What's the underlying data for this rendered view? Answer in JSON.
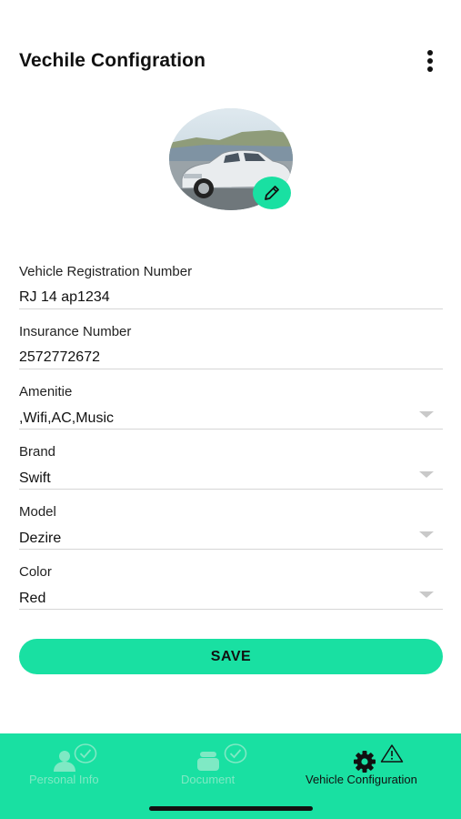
{
  "header": {
    "title": "Vechile Configration",
    "menu_icon": "more-vertical-icon"
  },
  "avatar": {
    "image": "car-photo",
    "edit_icon": "pencil-icon"
  },
  "form": {
    "fields": [
      {
        "label": "Vehicle Registration Number",
        "value": "RJ 14 ap1234",
        "type": "text"
      },
      {
        "label": "Insurance Number",
        "value": "2572772672",
        "type": "text"
      },
      {
        "label": "Amenitie",
        "value": ",Wifi,AC,Music",
        "type": "dropdown"
      },
      {
        "label": "Brand",
        "value": "Swift",
        "type": "dropdown"
      },
      {
        "label": "Model",
        "value": "Dezire",
        "type": "dropdown"
      },
      {
        "label": "Color",
        "value": "Red",
        "type": "dropdown"
      }
    ],
    "save_label": "SAVE"
  },
  "bottom_nav": {
    "items": [
      {
        "label": "Personal Info",
        "icon": "person-icon",
        "status": "check-circle-icon"
      },
      {
        "label": "Document",
        "icon": "document-stack-icon",
        "status": "check-circle-icon"
      },
      {
        "label": "Vehicle Configuration",
        "icon": "gear-icon",
        "status": "warning-icon"
      }
    ]
  },
  "colors": {
    "accent": "#19e0a2",
    "faded_nav": "#7fe9c4",
    "text": "#111111",
    "divider": "#d6d6d6"
  }
}
